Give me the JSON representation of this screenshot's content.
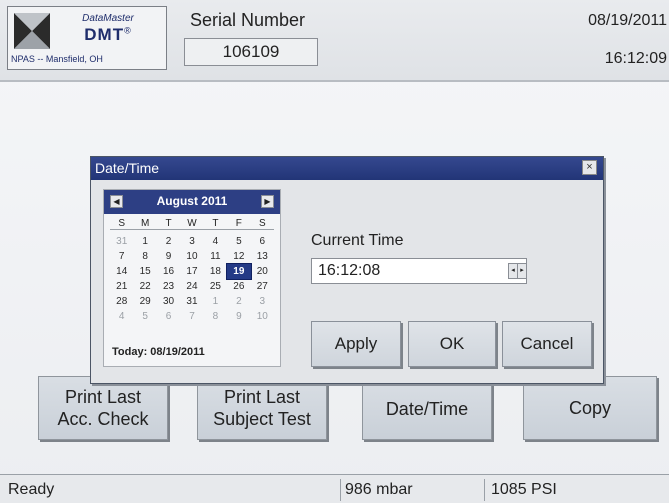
{
  "header": {
    "logo": {
      "brand": "DataMaster",
      "product": "DMT",
      "registered": "®",
      "location": "NPAS -- Mansfield, OH"
    },
    "serial_label": "Serial Number",
    "serial_value": "106109",
    "date": "08/19/2011",
    "time": "16:12:09"
  },
  "main": {
    "buttons": [
      {
        "label_line1": "Print Last",
        "label_line2": "Acc. Check"
      },
      {
        "label_line1": "Print Last",
        "label_line2": "Subject Test"
      },
      {
        "label": "Date/Time"
      },
      {
        "label": "Copy"
      }
    ]
  },
  "status_bar": {
    "state": "Ready",
    "pressure": "986 mbar",
    "psi": "1085 PSI"
  },
  "dialog": {
    "title": "Date/Time",
    "close_glyph": "×",
    "calendar": {
      "month_label": "August 2011",
      "prev_glyph": "◀",
      "next_glyph": "▶",
      "weekdays": [
        "S",
        "M",
        "T",
        "W",
        "T",
        "F",
        "S"
      ],
      "days": [
        {
          "d": "31",
          "muted": true
        },
        {
          "d": "1"
        },
        {
          "d": "2"
        },
        {
          "d": "3"
        },
        {
          "d": "4"
        },
        {
          "d": "5"
        },
        {
          "d": "6"
        },
        {
          "d": "7"
        },
        {
          "d": "8"
        },
        {
          "d": "9"
        },
        {
          "d": "10"
        },
        {
          "d": "11"
        },
        {
          "d": "12"
        },
        {
          "d": "13"
        },
        {
          "d": "14"
        },
        {
          "d": "15"
        },
        {
          "d": "16"
        },
        {
          "d": "17"
        },
        {
          "d": "18"
        },
        {
          "d": "19",
          "selected": true
        },
        {
          "d": "20"
        },
        {
          "d": "21"
        },
        {
          "d": "22"
        },
        {
          "d": "23"
        },
        {
          "d": "24"
        },
        {
          "d": "25"
        },
        {
          "d": "26"
        },
        {
          "d": "27"
        },
        {
          "d": "28"
        },
        {
          "d": "29"
        },
        {
          "d": "30"
        },
        {
          "d": "31"
        },
        {
          "d": "1",
          "muted": true
        },
        {
          "d": "2",
          "muted": true
        },
        {
          "d": "3",
          "muted": true
        },
        {
          "d": "4",
          "muted": true
        },
        {
          "d": "5",
          "muted": true
        },
        {
          "d": "6",
          "muted": true
        },
        {
          "d": "7",
          "muted": true
        },
        {
          "d": "8",
          "muted": true
        },
        {
          "d": "9",
          "muted": true
        },
        {
          "d": "10",
          "muted": true
        }
      ],
      "today_label": "Today: 08/19/2011"
    },
    "current_time_label": "Current Time",
    "current_time_value": "16:12:08",
    "spin_down_glyph": "◂",
    "spin_up_glyph": "▸",
    "apply_label": "Apply",
    "ok_label": "OK",
    "cancel_label": "Cancel"
  },
  "colors": {
    "titlebar": "#223577",
    "selected_day": "#243a86",
    "button_face": "#cfd5dc"
  }
}
